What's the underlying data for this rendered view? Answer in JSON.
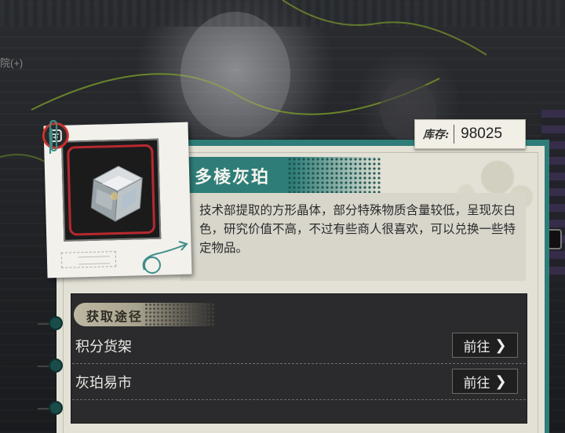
{
  "background": {
    "left_label": "院(+)"
  },
  "stock": {
    "label": "库存:",
    "value": "98025"
  },
  "item": {
    "name": "多棱灰珀",
    "description": "技术部提取的方形晶体，部分特殊物质含量较低，呈现灰白色，研究价值不高，不过有些商人很喜欢，可以兑换一些特定物品。",
    "image_icon": "crystal-cube-icon",
    "rank_icon": "rank-badge-icon"
  },
  "sources": {
    "header": "获取途径",
    "rows": [
      {
        "label": "积分货架",
        "button": "前往"
      },
      {
        "label": "灰珀易市",
        "button": "前往"
      }
    ]
  },
  "colors": {
    "teal_accent": "#2f7d78",
    "card_bg": "#e3e1d6",
    "panel_bg": "#2b2b2d",
    "frame_red": "#b7292f"
  }
}
